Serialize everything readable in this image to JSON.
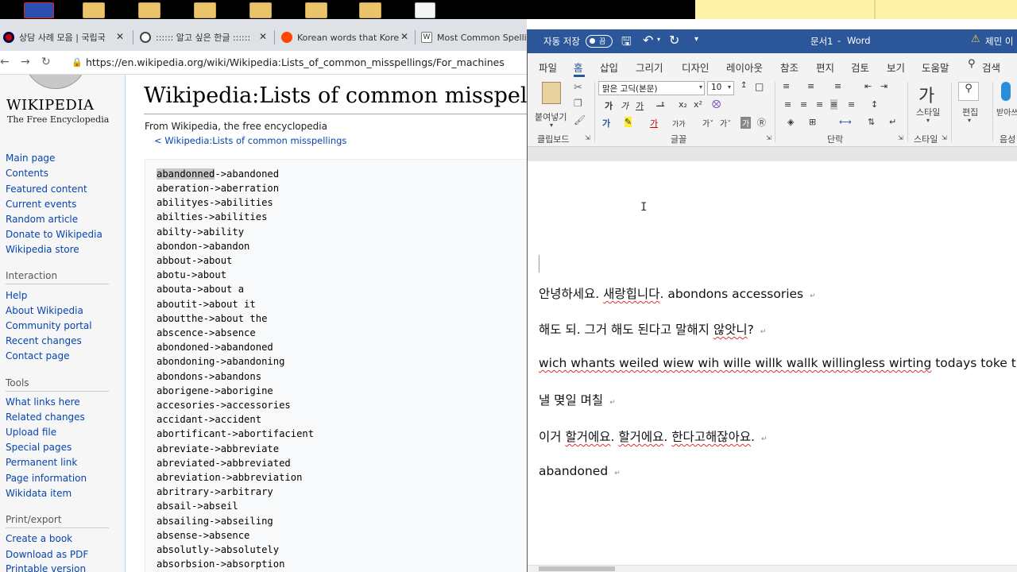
{
  "browser": {
    "tabs": [
      {
        "title": "상담 사례 모음 | 국립국",
        "close": "✕"
      },
      {
        "title": ":::::: 알고 싶은 한글 ::::::",
        "close": "✕"
      },
      {
        "title": "Korean words that Kore",
        "close": "✕"
      },
      {
        "title": "Most Common Spelling",
        "close": ""
      }
    ],
    "nav": {
      "back": "←",
      "forward": "→",
      "reload": "↻"
    },
    "url": "https://en.wikipedia.org/wiki/Wikipedia:Lists_of_common_misspellings/For_machines"
  },
  "wiki": {
    "logo_word": "WIKIPEDIA",
    "logo_slogan": "The Free Encyclopedia",
    "nav_links": [
      "Main page",
      "Contents",
      "Featured content",
      "Current events",
      "Random article",
      "Donate to Wikipedia",
      "Wikipedia store"
    ],
    "interaction_heading": "Interaction",
    "interaction_links": [
      "Help",
      "About Wikipedia",
      "Community portal",
      "Recent changes",
      "Contact page"
    ],
    "tools_heading": "Tools",
    "tools_links": [
      "What links here",
      "Related changes",
      "Upload file",
      "Special pages",
      "Permanent link",
      "Page information",
      "Wikidata item"
    ],
    "print_heading": "Print/export",
    "print_links": [
      "Create a book",
      "Download as PDF",
      "Printable version"
    ],
    "page_title": "Wikipedia:Lists of common misspellin",
    "from": "From Wikipedia, the free encyclopedia",
    "back_link": "< Wikipedia:Lists of common misspellings",
    "highlighted_word": "abandonned",
    "first_line_rest": "->abandoned",
    "lines": [
      "aberation->aberration",
      "abilityes->abilities",
      "abilties->abilities",
      "abilty->ability",
      "abondon->abandon",
      "abbout->about",
      "abotu->about",
      "abouta->about a",
      "aboutit->about it",
      "aboutthe->about the",
      "abscence->absence",
      "abondoned->abandoned",
      "abondoning->abandoning",
      "abondons->abandons",
      "aborigene->aborigine",
      "accesories->accessories",
      "accidant->accident",
      "abortificant->abortifacient",
      "abreviate->abbreviate",
      "abreviated->abbreviated",
      "abreviation->abbreviation",
      "abritrary->arbitrary",
      "absail->abseil",
      "absailing->abseiling",
      "absense->absence",
      "absolutly->absolutely",
      "absorbsion->absorption"
    ]
  },
  "word": {
    "autosave_label": "자동 저장",
    "autosave_state": "끔",
    "doc_title": "문서1",
    "title_sep": "-",
    "app_name": "Word",
    "warning_user": "제민 이",
    "menu": [
      "파일",
      "홈",
      "삽입",
      "그리기",
      "디자인",
      "레이아웃",
      "참조",
      "편지",
      "검토",
      "보기",
      "도움말",
      "검색"
    ],
    "ribbon": {
      "paste_label": "붙여넣기",
      "clipboard_group": "클립보드",
      "font_name": "맑은 고딕(본문)",
      "font_size": "10",
      "font_group": "글꼴",
      "paragraph_group": "단락",
      "style_label": "스타일",
      "style_group": "스타일",
      "edit_label": "편집",
      "dictate_label": "받아쓰기",
      "voice_group": "음성"
    },
    "doc_lines": [
      [
        {
          "t": "안녕하세요. ",
          "e": false
        },
        {
          "t": "새랑힙니다",
          "e": true
        },
        {
          "t": ". abondons accessories",
          "e": false
        }
      ],
      [
        {
          "t": "해도 되. 그거 해도 된다고 말해지 ",
          "e": false
        },
        {
          "t": "않앗니",
          "e": true
        },
        {
          "t": "?",
          "e": false
        }
      ],
      [
        {
          "t": "wich whants weiled wiew wih wille willk wallk willingless wirting",
          "e": true
        },
        {
          "t": " todays toke t",
          "e": false
        }
      ],
      [
        {
          "t": "낼 몆일 며칠",
          "e": false
        }
      ],
      [
        {
          "t": "이거 ",
          "e": false
        },
        {
          "t": "할거에요",
          "e": true
        },
        {
          "t": ". ",
          "e": false
        },
        {
          "t": "할거에요",
          "e": true
        },
        {
          "t": ". ",
          "e": false
        },
        {
          "t": "한다고해잖아요",
          "e": true
        },
        {
          "t": ".",
          "e": false
        }
      ],
      [
        {
          "t": "abandoned",
          "e": false
        }
      ]
    ],
    "para_mark": "↵"
  },
  "colors": {
    "word_blue": "#2b579a",
    "wiki_link": "#0645ad",
    "squiggle": "#e03030"
  }
}
